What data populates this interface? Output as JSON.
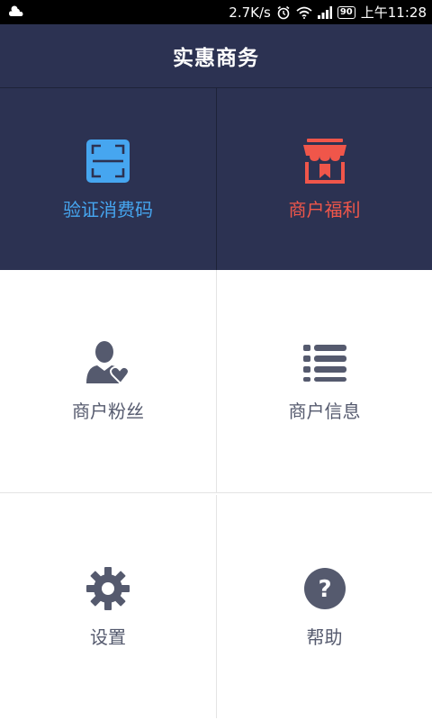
{
  "status_bar": {
    "speed": "2.7K/s",
    "battery": "90",
    "time": "上午11:28"
  },
  "header": {
    "title": "实惠商务"
  },
  "tiles": [
    {
      "label": "验证消费码",
      "icon": "scan-code-icon",
      "color": "#46a6f0"
    },
    {
      "label": "商户福利",
      "icon": "store-icon",
      "color": "#f0564a"
    },
    {
      "label": "商户粉丝",
      "icon": "user-heart-icon",
      "color": "#555a6e"
    },
    {
      "label": "商户信息",
      "icon": "list-icon",
      "color": "#555a6e"
    },
    {
      "label": "设置",
      "icon": "gear-icon",
      "color": "#555a6e"
    },
    {
      "label": "帮助",
      "icon": "help-icon",
      "color": "#555a6e"
    }
  ],
  "colors": {
    "header_bg": "#2c3252",
    "icon_gray": "#555a6e"
  }
}
